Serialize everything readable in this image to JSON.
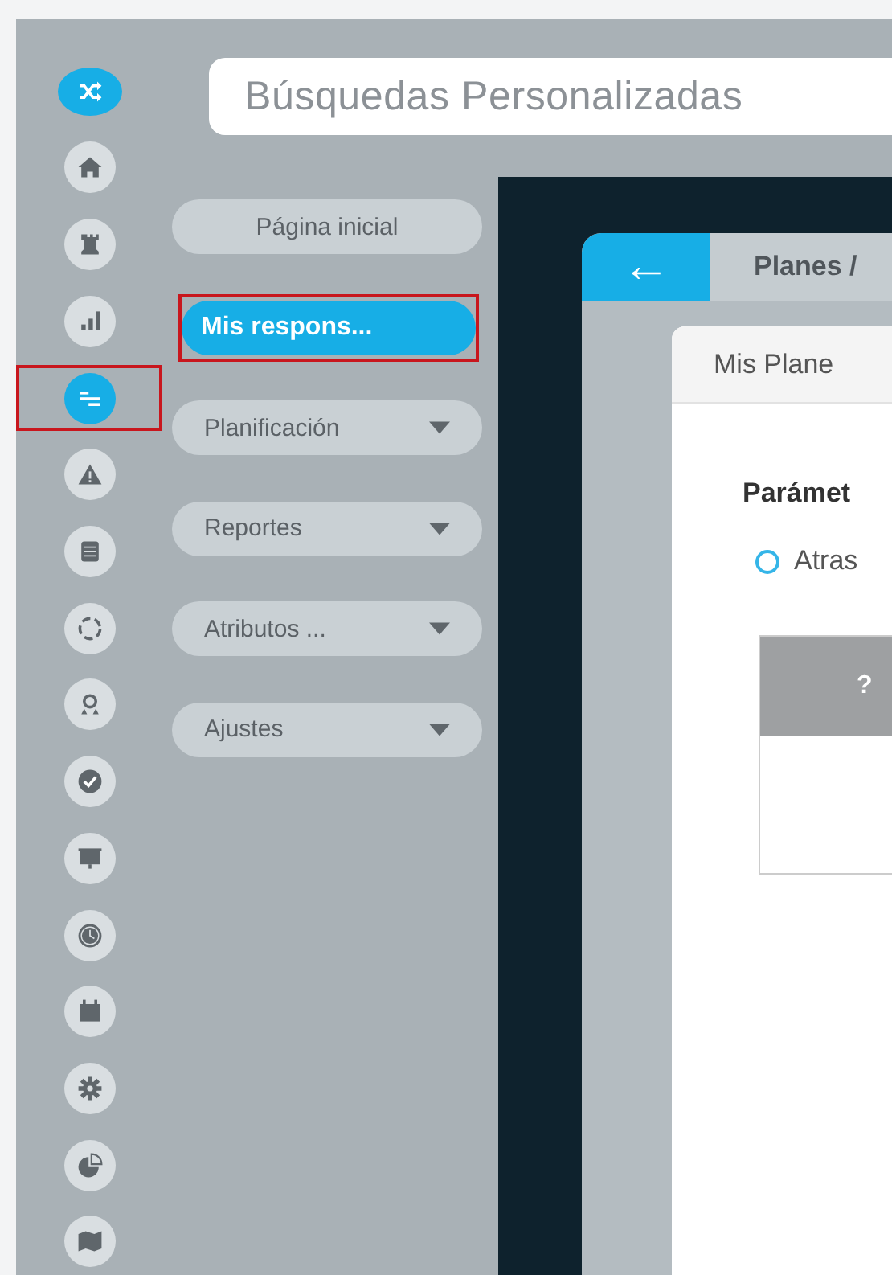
{
  "rail": [
    {
      "selected": true,
      "highlighted": false
    },
    {
      "selected": false,
      "highlighted": false
    },
    {
      "selected": false,
      "highlighted": false
    },
    {
      "selected": false,
      "highlighted": false
    },
    {
      "selected": true,
      "highlighted": true
    },
    {
      "selected": false,
      "highlighted": false
    },
    {
      "selected": false,
      "highlighted": false
    },
    {
      "selected": false,
      "highlighted": false
    },
    {
      "selected": false,
      "highlighted": false
    },
    {
      "selected": false,
      "highlighted": false
    },
    {
      "selected": false,
      "highlighted": false
    },
    {
      "selected": false,
      "highlighted": false
    },
    {
      "selected": false,
      "highlighted": false
    },
    {
      "selected": false,
      "highlighted": false
    },
    {
      "selected": false,
      "highlighted": false
    },
    {
      "selected": false,
      "highlighted": false
    }
  ],
  "search": {
    "placeholder": "Búsquedas Personalizadas"
  },
  "menu": [
    {
      "label": "Página inicial",
      "selected": false,
      "highlighted": false,
      "dropdown": false
    },
    {
      "label": "Mis respons...",
      "selected": true,
      "highlighted": true,
      "dropdown": false
    },
    {
      "label": "Planificación",
      "selected": false,
      "highlighted": false,
      "dropdown": true
    },
    {
      "label": "Reportes",
      "selected": false,
      "highlighted": false,
      "dropdown": true
    },
    {
      "label": "Atributos ...",
      "selected": false,
      "highlighted": false,
      "dropdown": true
    },
    {
      "label": "Ajustes",
      "selected": false,
      "highlighted": false,
      "dropdown": true
    }
  ],
  "card": {
    "back": "←",
    "breadcrumb": "Planes /",
    "tab": "Mis Plane",
    "section_title": "Parámet",
    "radio": {
      "label": "Atras",
      "selected": false
    },
    "table": {
      "columns": [
        "?"
      ]
    }
  }
}
